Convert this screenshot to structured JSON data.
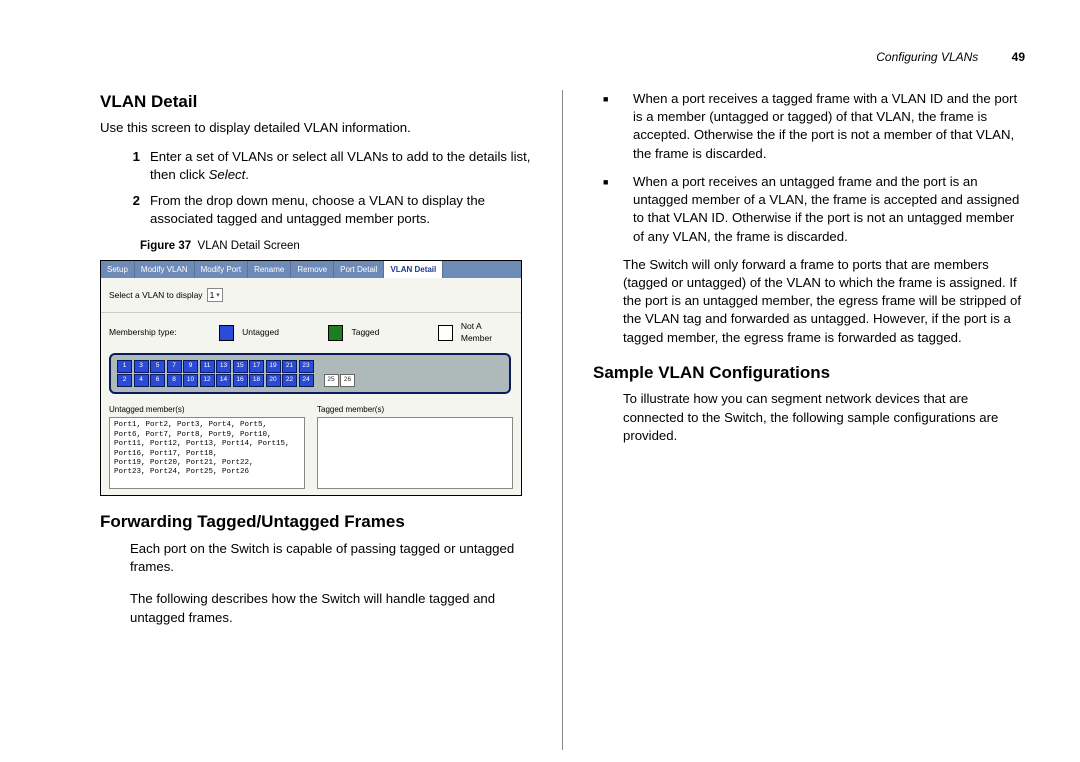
{
  "header": {
    "chapter": "Configuring VLANs",
    "page": "49"
  },
  "left": {
    "h_vlan_detail": "VLAN Detail",
    "intro": "Use this screen to display detailed VLAN information.",
    "steps": [
      {
        "n": "1",
        "text_pre": "Enter a set of VLANs or select all VLANs to add to the details list, then click ",
        "text_em": "Select",
        "text_post": "."
      },
      {
        "n": "2",
        "text_pre": "From the drop down menu, choose a VLAN to display the associated tagged and untagged member ports.",
        "text_em": "",
        "text_post": ""
      }
    ],
    "figure_label": "Figure 37",
    "figure_title": "VLAN Detail Screen",
    "screenshot": {
      "tabs": [
        "Setup",
        "Modify VLAN",
        "Modify Port",
        "Rename",
        "Remove",
        "Port Detail",
        "VLAN Detail"
      ],
      "active_tab": 6,
      "select_label": "Select a VLAN to display",
      "select_value": "1",
      "membership_label": "Membership type:",
      "legend": [
        {
          "color": "blue",
          "label": "Untagged"
        },
        {
          "color": "green",
          "label": "Tagged"
        },
        {
          "color": "white",
          "label": "Not A Member"
        }
      ],
      "ports_top": [
        "1",
        "3",
        "5",
        "7",
        "9",
        "11",
        "13",
        "15",
        "17",
        "19",
        "21",
        "23"
      ],
      "ports_bot": [
        "2",
        "4",
        "6",
        "8",
        "10",
        "12",
        "14",
        "16",
        "18",
        "20",
        "22",
        "24"
      ],
      "ports_extra": [
        "25",
        "26"
      ],
      "untagged_label": "Untagged member(s)",
      "untagged_text": "Port1, Port2, Port3, Port4, Port5,\nPort6, Port7, Port8, Port9, Port10,\nPort11, Port12, Port13, Port14, Port15,\nPort16, Port17, Port18,\nPort19, Port20, Port21, Port22,\nPort23, Port24, Port25, Port26",
      "tagged_label": "Tagged member(s)",
      "tagged_text": ""
    },
    "h_forwarding": "Forwarding Tagged/Untagged Frames",
    "p_forward_1": "Each port on the Switch is capable of passing tagged or untagged frames.",
    "p_forward_2": "The following describes how the Switch will handle tagged and untagged frames."
  },
  "right": {
    "bullets": [
      "When a port receives a tagged frame with a VLAN ID and the port is a member (untagged or tagged) of that VLAN, the frame is accepted. Otherwise the if the port is not a member of that VLAN, the frame is discarded.",
      "When a port receives an untagged frame and the port is an untagged member of a VLAN, the frame is accepted and assigned to that VLAN ID. Otherwise if the port is not an untagged member of any VLAN, the frame is discarded."
    ],
    "p_switch": "The Switch will only forward a frame to ports that are members (tagged or untagged) of the VLAN to which the frame is assigned. If the port is an untagged member, the egress frame will be stripped of the VLAN tag and forwarded as untagged. However, if the port is a tagged member, the egress frame is forwarded as tagged.",
    "h_sample": "Sample VLAN Configurations",
    "p_sample": "To illustrate how you can segment network devices that are connected to the Switch, the following sample configurations are provided."
  }
}
